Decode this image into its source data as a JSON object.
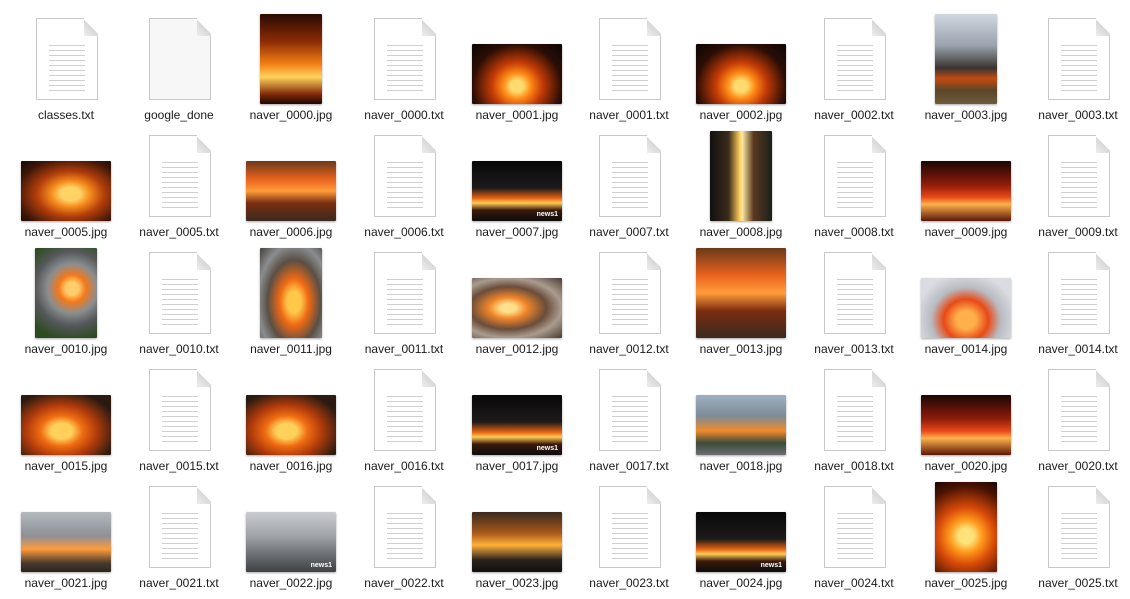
{
  "files": [
    {
      "name": "classes.txt",
      "kind": "txt"
    },
    {
      "name": "google_done",
      "kind": "blank"
    },
    {
      "name": "naver_0000.jpg",
      "kind": "jpg",
      "thumb": "f-b",
      "orient": "portrait"
    },
    {
      "name": "naver_0000.txt",
      "kind": "txt"
    },
    {
      "name": "naver_0001.jpg",
      "kind": "jpg",
      "thumb": "f-c",
      "orient": "landscape"
    },
    {
      "name": "naver_0001.txt",
      "kind": "txt"
    },
    {
      "name": "naver_0002.jpg",
      "kind": "jpg",
      "thumb": "f-c",
      "orient": "landscape"
    },
    {
      "name": "naver_0002.txt",
      "kind": "txt"
    },
    {
      "name": "naver_0003.jpg",
      "kind": "jpg",
      "thumb": "f-d",
      "orient": "portrait"
    },
    {
      "name": "naver_0003.txt",
      "kind": "txt"
    },
    {
      "name": "naver_0005.jpg",
      "kind": "jpg",
      "thumb": "f-e",
      "orient": "landscape"
    },
    {
      "name": "naver_0005.txt",
      "kind": "txt"
    },
    {
      "name": "naver_0006.jpg",
      "kind": "jpg",
      "thumb": "f-l",
      "orient": "landscape"
    },
    {
      "name": "naver_0006.txt",
      "kind": "txt"
    },
    {
      "name": "naver_0007.jpg",
      "kind": "jpg",
      "thumb": "f-f",
      "orient": "landscape",
      "logo": "news1"
    },
    {
      "name": "naver_0007.txt",
      "kind": "txt"
    },
    {
      "name": "naver_0008.jpg",
      "kind": "jpg",
      "thumb": "f-g",
      "orient": "portrait"
    },
    {
      "name": "naver_0008.txt",
      "kind": "txt"
    },
    {
      "name": "naver_0009.jpg",
      "kind": "jpg",
      "thumb": "f-h",
      "orient": "landscape"
    },
    {
      "name": "naver_0009.txt",
      "kind": "txt"
    },
    {
      "name": "naver_0010.jpg",
      "kind": "jpg",
      "thumb": "f-i",
      "orient": "portrait"
    },
    {
      "name": "naver_0010.txt",
      "kind": "txt"
    },
    {
      "name": "naver_0011.jpg",
      "kind": "jpg",
      "thumb": "f-j",
      "orient": "portrait"
    },
    {
      "name": "naver_0011.txt",
      "kind": "txt"
    },
    {
      "name": "naver_0012.jpg",
      "kind": "jpg",
      "thumb": "f-k",
      "orient": "landscape"
    },
    {
      "name": "naver_0012.txt",
      "kind": "txt"
    },
    {
      "name": "naver_0013.jpg",
      "kind": "jpg",
      "thumb": "f-l",
      "orient": "square"
    },
    {
      "name": "naver_0013.txt",
      "kind": "txt"
    },
    {
      "name": "naver_0014.jpg",
      "kind": "jpg",
      "thumb": "f-m",
      "orient": "landscape"
    },
    {
      "name": "naver_0014.txt",
      "kind": "txt"
    },
    {
      "name": "naver_0015.jpg",
      "kind": "jpg",
      "thumb": "f-o",
      "orient": "landscape"
    },
    {
      "name": "naver_0015.txt",
      "kind": "txt"
    },
    {
      "name": "naver_0016.jpg",
      "kind": "jpg",
      "thumb": "f-o",
      "orient": "landscape"
    },
    {
      "name": "naver_0016.txt",
      "kind": "txt"
    },
    {
      "name": "naver_0017.jpg",
      "kind": "jpg",
      "thumb": "f-f",
      "orient": "landscape",
      "logo": "news1"
    },
    {
      "name": "naver_0017.txt",
      "kind": "txt"
    },
    {
      "name": "naver_0018.jpg",
      "kind": "jpg",
      "thumb": "f-p",
      "orient": "landscape"
    },
    {
      "name": "naver_0018.txt",
      "kind": "txt"
    },
    {
      "name": "naver_0020.jpg",
      "kind": "jpg",
      "thumb": "f-h",
      "orient": "landscape"
    },
    {
      "name": "naver_0020.txt",
      "kind": "txt"
    },
    {
      "name": "naver_0021.jpg",
      "kind": "jpg",
      "thumb": "f-n",
      "orient": "landscape"
    },
    {
      "name": "naver_0021.txt",
      "kind": "txt"
    },
    {
      "name": "naver_0022.jpg",
      "kind": "jpg",
      "thumb": "f-q",
      "orient": "landscape",
      "logo": "news1"
    },
    {
      "name": "naver_0022.txt",
      "kind": "txt"
    },
    {
      "name": "naver_0023.jpg",
      "kind": "jpg",
      "thumb": "f-r",
      "orient": "landscape"
    },
    {
      "name": "naver_0023.txt",
      "kind": "txt"
    },
    {
      "name": "naver_0024.jpg",
      "kind": "jpg",
      "thumb": "f-f",
      "orient": "landscape",
      "logo": "news1"
    },
    {
      "name": "naver_0024.txt",
      "kind": "txt"
    },
    {
      "name": "naver_0025.jpg",
      "kind": "jpg",
      "thumb": "f-a",
      "orient": "portrait"
    },
    {
      "name": "naver_0025.txt",
      "kind": "txt"
    }
  ]
}
